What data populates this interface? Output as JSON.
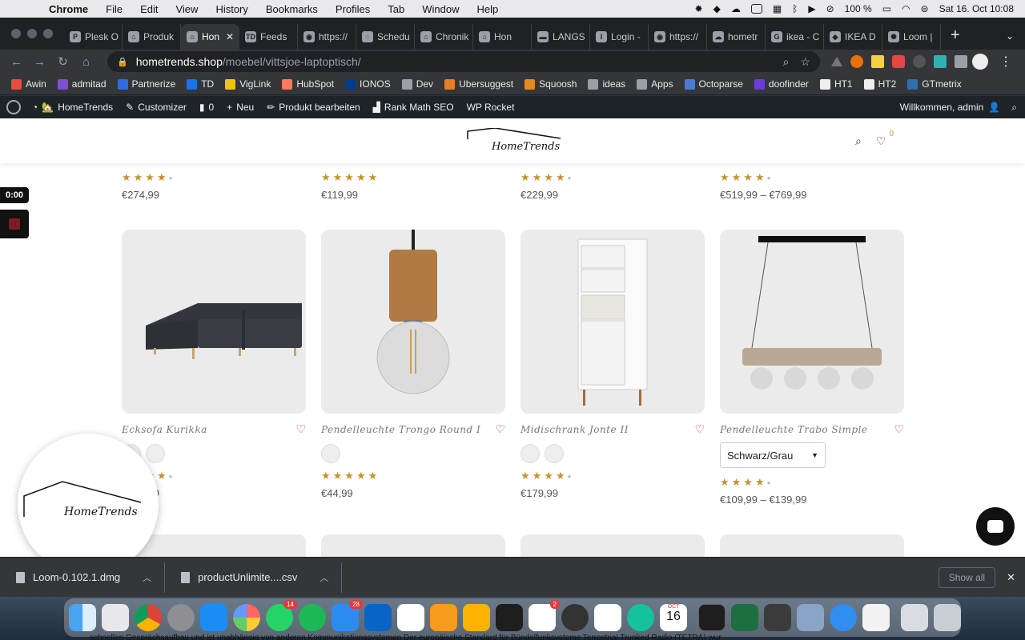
{
  "menubar": {
    "app_name": "Chrome",
    "items": [
      "File",
      "Edit",
      "View",
      "History",
      "Bookmarks",
      "Profiles",
      "Tab",
      "Window",
      "Help"
    ],
    "battery": "100 %",
    "datetime": "Sat 16. Oct  10:08"
  },
  "tabs": [
    {
      "label": "Plesk O",
      "fav": "P"
    },
    {
      "label": "Produk",
      "fav": "⌂"
    },
    {
      "label": "Hon",
      "fav": "⌂",
      "active": true
    },
    {
      "label": "Feeds",
      "fav": "TD"
    },
    {
      "label": "https://",
      "fav": "◉"
    },
    {
      "label": "Schedu",
      "fav": "◌"
    },
    {
      "label": "Chronik",
      "fav": "⌂"
    },
    {
      "label": "Hon",
      "fav": "⌂"
    },
    {
      "label": "LANGS",
      "fav": "▬"
    },
    {
      "label": "Login -",
      "fav": "I"
    },
    {
      "label": "https://",
      "fav": "◉"
    },
    {
      "label": "hometr",
      "fav": "☁"
    },
    {
      "label": "ikea - C",
      "fav": "G"
    },
    {
      "label": "IKEA D",
      "fav": "◆"
    },
    {
      "label": "Loom |",
      "fav": "✺"
    }
  ],
  "address": {
    "host": "hometrends.shop",
    "path": "/moebel/vittsjoe-laptoptisch/"
  },
  "bookmarks": [
    "Awin",
    "admitad",
    "Partnerize",
    "TD",
    "VigLink",
    "HubSpot",
    "IONOS",
    "Dev",
    "Ubersuggest",
    "Squoosh",
    "ideas",
    "Apps",
    "Octoparse",
    "doofinder",
    "HT1",
    "HT2",
    "GTmetrix"
  ],
  "wpbar": {
    "site": "HomeTrends",
    "customizer": "Customizer",
    "comments": "0",
    "new": "Neu",
    "edit_product": "Produkt bearbeiten",
    "seo": "Rank Math SEO",
    "rocket": "WP Rocket",
    "greeting": "Willkommen, admin"
  },
  "site": {
    "logo_text": "HomeTrends",
    "wishlist_count": "0"
  },
  "top_row": [
    {
      "rating": 4,
      "price": "€274,99"
    },
    {
      "rating": 5,
      "price": "€119,99"
    },
    {
      "rating": 4,
      "price": "€229,99"
    },
    {
      "rating": 4,
      "price": "€519,99 – €769,99"
    }
  ],
  "products": [
    {
      "title": "Ecksofa Kurikka",
      "rating": 4,
      "price": "€274,99",
      "swatches": 2
    },
    {
      "title": "Pendelleuchte Trongo Round I",
      "rating": 5,
      "price": "€44,99",
      "swatches": 1
    },
    {
      "title": "Midischrank Jonte II",
      "rating": 4,
      "price": "€179,99",
      "swatches": 2
    },
    {
      "title": "Pendelleuchte Trabo Simple",
      "rating": 4,
      "price": "€109,99 – €139,99",
      "select": "Schwarz/Grau"
    }
  ],
  "recorder": {
    "time": "0:00",
    "bubble_text": "HomeTrends"
  },
  "downloads": {
    "items": [
      "Loom-0.102.1.dmg",
      "productUnlimite....csv"
    ],
    "show_all": "Show all"
  },
  "dock": {
    "badges": {
      "whatsapp": "14",
      "mail": "28",
      "reminders": "2"
    },
    "calendar_month": "OCT",
    "calendar_day": "16"
  },
  "caption": "schnellen Gesprächsaufbau und ist unabhängig von anderen Kommunikationssystemen       Der europäische Standard für Bündelfunksysteme Terrestrial Trunked Radio (TETRA) wur",
  "colors": {
    "star": "#c6922a",
    "heart": "#b02b3a",
    "wpbar": "#1d2327"
  }
}
